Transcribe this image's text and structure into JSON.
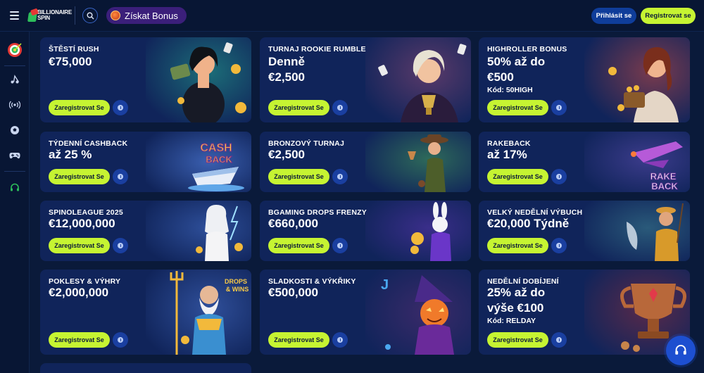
{
  "header": {
    "logo_line1": "BILLIONAIRE",
    "logo_line2": "SPIN",
    "bonus_label": "Získat Bonus",
    "login_label": "Přihlásit se",
    "register_label": "Registrovat se"
  },
  "sidebar": {
    "items": [
      {
        "icon": "target-icon"
      },
      {
        "icon": "music-icon"
      },
      {
        "icon": "live-signal-icon"
      },
      {
        "icon": "soccer-ball-icon"
      },
      {
        "icon": "gamepad-icon"
      },
      {
        "icon": "headset-icon"
      }
    ]
  },
  "cards": [
    {
      "title": "ŠTĚSTÍ RUSH",
      "value": "€75,000",
      "cta": "Zaregistrovat Se"
    },
    {
      "title": "TURNAJ ROOKIE RUMBLE",
      "value_line1": "Denně",
      "value_line2": "€2,500",
      "cta": "Zaregistrovat Se"
    },
    {
      "title": "HIGHROLLER BONUS",
      "value_line1": "50% až do",
      "value_line2": "€500",
      "code": "Kód: 50HIGH",
      "cta": "Zaregistrovat Se"
    },
    {
      "title": "TÝDENNÍ CASHBACK",
      "value": "až 25 %",
      "cta": "Zaregistrovat Se"
    },
    {
      "title": "BRONZOVÝ TURNAJ",
      "value": "€2,500",
      "cta": "Zaregistrovat Se"
    },
    {
      "title": "RAKEBACK",
      "value": "až 17%",
      "cta": "Zaregistrovat Se"
    },
    {
      "title": "SPINOLEAGUE 2025",
      "value": "€12,000,000",
      "cta": "Zaregistrovat Se"
    },
    {
      "title": "BGAMING DROPS FRENZY",
      "value": "€660,000",
      "cta": "Zaregistrovat Se"
    },
    {
      "title": "VELKÝ NEDĚLNÍ VÝBUCH",
      "value": "€20,000 Týdně",
      "cta": "Zaregistrovat Se"
    },
    {
      "title": "POKLESY & VÝHRY",
      "value": "€2,000,000",
      "cta": "Zaregistrovat Se"
    },
    {
      "title": "SLADKOSTI & VÝKŘIKY",
      "value": "€500,000",
      "cta": "Zaregistrovat Se"
    },
    {
      "title": "NEDĚLNÍ DOBÍJENÍ",
      "value_line1": "25% až do",
      "value_line2": "výše €100",
      "code": "Kód: RELDAY",
      "cta": "Zaregistrovat Se"
    }
  ],
  "art_text": {
    "cashback_1": "CASH",
    "cashback_2": "BACK",
    "rakeback_1": "RAKE",
    "rakeback_2": "BACK",
    "drops_1": "DROPS",
    "drops_2": "& WINS"
  },
  "colors": {
    "background": "#0a1a3a",
    "card": "#10245a",
    "accent_lime": "#c6f432",
    "login_blue": "#0f3d9a",
    "bonus_purple": "#3b1f7a"
  }
}
